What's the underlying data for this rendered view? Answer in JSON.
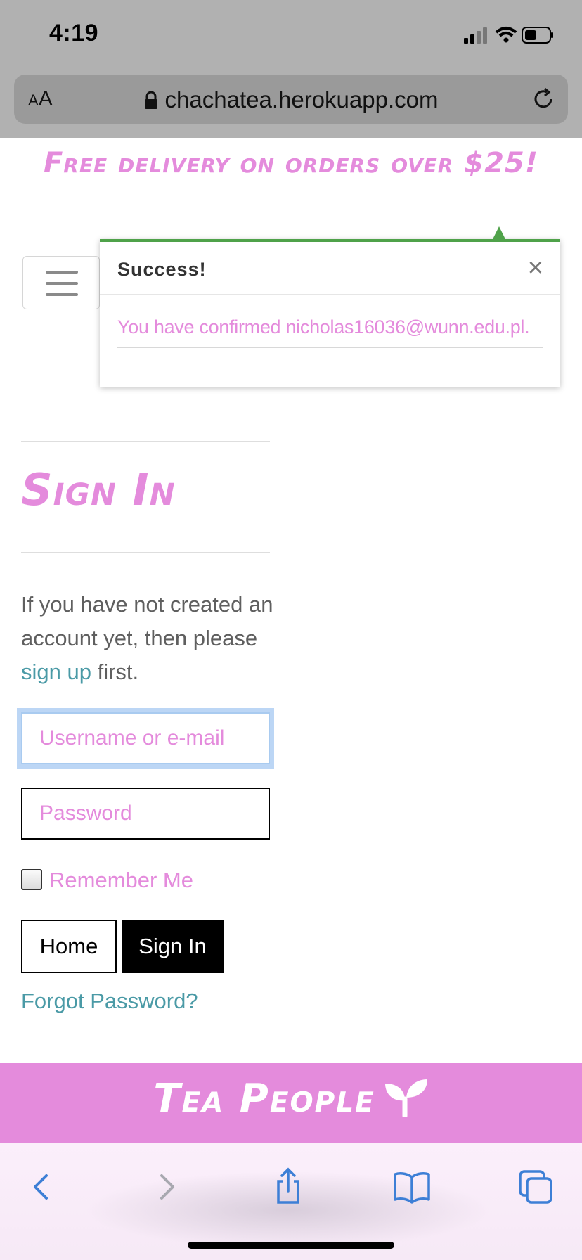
{
  "status_bar": {
    "time": "4:19"
  },
  "browser": {
    "aa_label_small": "A",
    "aa_label_large": "A",
    "url": "chachatea.herokuapp.com"
  },
  "page": {
    "promo_banner": "Free delivery on orders over $25!",
    "toast": {
      "title": "Success!",
      "close_symbol": "×",
      "message": "You have confirmed nicholas16036@wunn.edu.pl."
    },
    "signin": {
      "title": "Sign In",
      "intro_before": "If you have not created an account yet, then please ",
      "intro_link": "sign up",
      "intro_after": " first.",
      "username_placeholder": "Username or e-mail",
      "password_placeholder": "Password",
      "remember_label": "Remember Me",
      "home_button": "Home",
      "signin_button": "Sign In",
      "forgot_link": "Forgot Password?"
    },
    "footer": {
      "brand": "Tea People"
    }
  },
  "colors": {
    "accent_pink": "#e48bdc",
    "link_teal": "#4a9aa6",
    "success_green": "#4fa24a"
  }
}
